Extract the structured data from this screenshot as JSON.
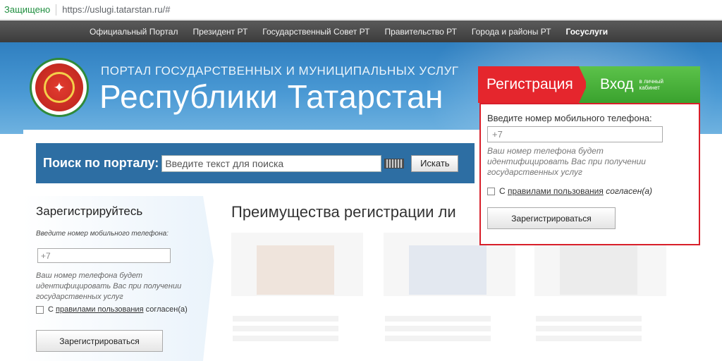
{
  "browser": {
    "secure_label": "Защищено",
    "url": "https://uslugi.tatarstan.ru/#"
  },
  "topnav": {
    "items": [
      "Официальный Портал",
      "Президент РТ",
      "Государственный Совет РТ",
      "Правительство РТ",
      "Города и районы РТ",
      "Госуслуги"
    ],
    "active_index": 5
  },
  "hero": {
    "subtitle": "ПОРТАЛ ГОСУДАРСТВЕННЫХ И МУНИЦИПАЛЬНЫХ УСЛУГ",
    "title": "Республики Татарстан"
  },
  "search": {
    "label": "Поиск по порталу:",
    "placeholder": "Введите текст для поиска",
    "button": "Искать"
  },
  "left_register": {
    "heading": "Зарегистрируйтесь",
    "phone_label": "Введите номер мобильного телефона:",
    "phone_value": "+7",
    "hint": "Ваш номер телефона будет идентифицировать Вас при получении государственных услуг",
    "agree_prefix": "С",
    "agree_link": "правилами пользования",
    "agree_suffix": "согласен(а)",
    "button": "Зарегистрироваться"
  },
  "advantages": {
    "title": "Преимущества регистрации ли"
  },
  "modal": {
    "tab_register": "Регистрация",
    "tab_login": "Вход",
    "tab_login_sub": "в личный кабинет",
    "phone_label": "Введите номер мобильного телефона:",
    "phone_value": "+7",
    "hint": "Ваш номер телефона будет идентифицировать Вас при получении государственных услуг",
    "agree_prefix": "С",
    "agree_link": "правилами пользования",
    "agree_suffix": "согласен(а)",
    "button": "Зарегистрироваться"
  },
  "colors": {
    "accent_red": "#e5262d",
    "accent_green": "#3aa22e",
    "hero_blue": "#2f7fc0",
    "search_blue": "#2d6ea3"
  }
}
